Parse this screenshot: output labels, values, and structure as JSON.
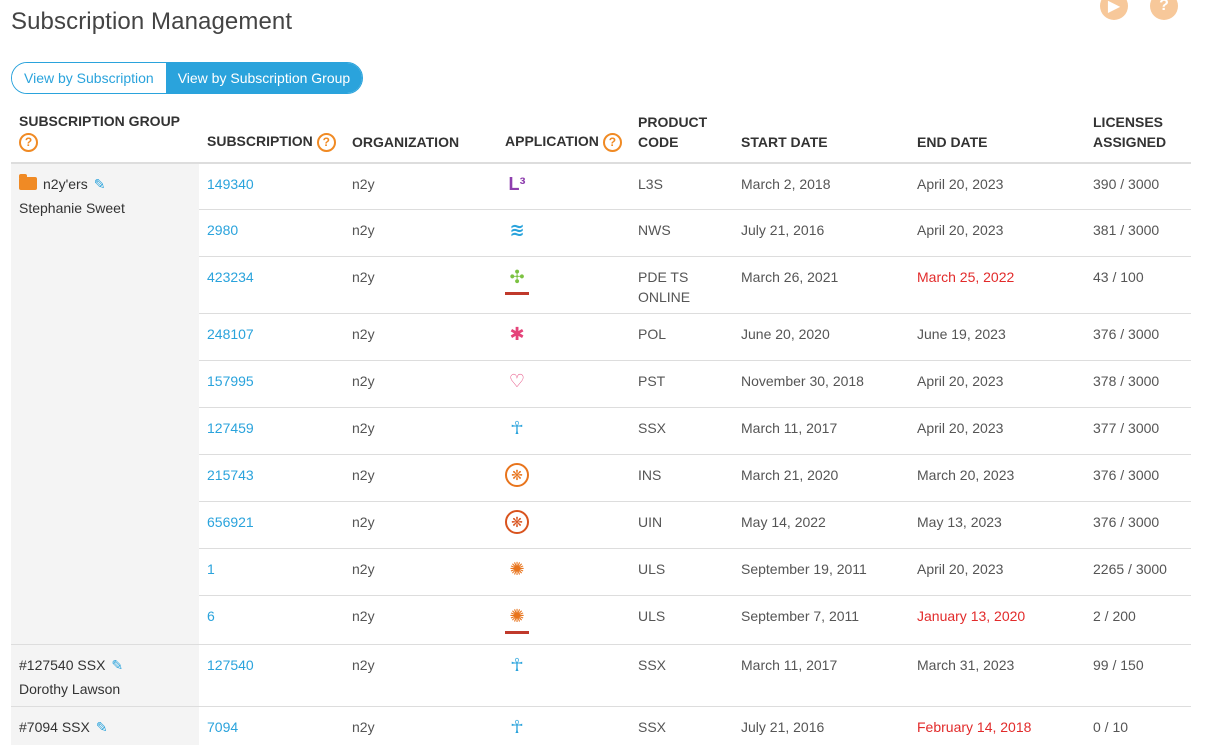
{
  "page": {
    "title": "Subscription Management"
  },
  "header_icons": [
    {
      "name": "play-icon",
      "glyph": "▶"
    },
    {
      "name": "help-icon",
      "glyph": "?"
    }
  ],
  "view_toggle": {
    "by_subscription": "View by Subscription",
    "by_group": "View by Subscription Group",
    "active": "by_group"
  },
  "columns": {
    "group": "SUBSCRIPTION GROUP",
    "subscription": "SUBSCRIPTION",
    "organization": "ORGANIZATION",
    "application": "APPLICATION",
    "product_code": "PRODUCT CODE",
    "start_date": "START DATE",
    "end_date": "END DATE",
    "licenses": "LICENSES ASSIGNED",
    "help_glyph": "?"
  },
  "colors": {
    "accent": "#2aa3dc",
    "orange": "#f08a24",
    "expired": "#e22b2b"
  },
  "groups": [
    {
      "name": "n2y'ers",
      "owner": "Stephanie Sweet",
      "folder": true,
      "rows": [
        {
          "subscription": "149340",
          "organization": "n2y",
          "app_icon": "l3-icon",
          "glyph": "L³",
          "color": "#8e3fae",
          "product_code": "L3S",
          "start": "March 2, 2018",
          "end": "April 20, 2023",
          "end_expired": false,
          "licenses": "390 / 3000"
        },
        {
          "subscription": "2980",
          "organization": "n2y",
          "app_icon": "news2you-icon",
          "glyph": "≋",
          "color": "#2aa3dc",
          "product_code": "NWS",
          "start": "July 21, 2016",
          "end": "April 20, 2023",
          "end_expired": false,
          "licenses": "381 / 3000"
        },
        {
          "subscription": "423234",
          "organization": "n2y",
          "app_icon": "positivity-icon",
          "glyph": "✣",
          "color": "#7cc242",
          "product_code": "PDE TS ONLINE",
          "start": "March 26, 2021",
          "end": "March 25, 2022",
          "end_expired": true,
          "licenses": "43 / 100",
          "underlined": true
        },
        {
          "subscription": "248107",
          "organization": "n2y",
          "app_icon": "pol-icon",
          "glyph": "✱",
          "color": "#e5447a",
          "product_code": "POL",
          "start": "June 20, 2020",
          "end": "June 19, 2023",
          "end_expired": false,
          "licenses": "376 / 3000"
        },
        {
          "subscription": "157995",
          "organization": "n2y",
          "app_icon": "heart-icon",
          "glyph": "♡",
          "color": "#e5447a",
          "product_code": "PST",
          "start": "November 30, 2018",
          "end": "April 20, 2023",
          "end_expired": false,
          "licenses": "378 / 3000"
        },
        {
          "subscription": "127459",
          "organization": "n2y",
          "app_icon": "ssx-figure-icon",
          "glyph": "☥",
          "color": "#2aa3dc",
          "product_code": "SSX",
          "start": "March 11, 2017",
          "end": "April 20, 2023",
          "end_expired": false,
          "licenses": "377 / 3000"
        },
        {
          "subscription": "215743",
          "organization": "n2y",
          "app_icon": "ins-icon",
          "glyph": "❋",
          "color": "#e8741c",
          "product_code": "INS",
          "start": "March 21, 2020",
          "end": "March 20, 2023",
          "end_expired": false,
          "licenses": "376 / 3000",
          "ring": true
        },
        {
          "subscription": "656921",
          "organization": "n2y",
          "app_icon": "uin-icon",
          "glyph": "❋",
          "color": "#d9531e",
          "product_code": "UIN",
          "start": "May 14, 2022",
          "end": "May 13, 2023",
          "end_expired": false,
          "licenses": "376 / 3000",
          "ring": true
        },
        {
          "subscription": "1",
          "organization": "n2y",
          "app_icon": "uls-icon",
          "glyph": "✺",
          "color": "#e8741c",
          "product_code": "ULS",
          "start": "September 19, 2011",
          "end": "April 20, 2023",
          "end_expired": false,
          "licenses": "2265 / 3000"
        },
        {
          "subscription": "6",
          "organization": "n2y",
          "app_icon": "uls-icon",
          "glyph": "✺",
          "color": "#e8741c",
          "product_code": "ULS",
          "start": "September 7, 2011",
          "end": "January 13, 2020",
          "end_expired": true,
          "licenses": "2 / 200",
          "underlined": true
        }
      ]
    },
    {
      "name": "#127540 SSX",
      "owner": "Dorothy Lawson",
      "folder": false,
      "rows": [
        {
          "subscription": "127540",
          "organization": "n2y",
          "app_icon": "ssx-figure-icon",
          "glyph": "☥",
          "color": "#2aa3dc",
          "product_code": "SSX",
          "start": "March 11, 2017",
          "end": "March 31, 2023",
          "end_expired": false,
          "licenses": "99 / 150"
        }
      ]
    },
    {
      "name": "#7094 SSX",
      "owner": "",
      "folder": false,
      "rows": [
        {
          "subscription": "7094",
          "organization": "n2y",
          "app_icon": "ssx-figure-icon",
          "glyph": "☥",
          "color": "#2aa3dc",
          "product_code": "SSX",
          "start": "July 21, 2016",
          "end": "February 14, 2018",
          "end_expired": true,
          "licenses": "0 / 10"
        }
      ]
    }
  ]
}
